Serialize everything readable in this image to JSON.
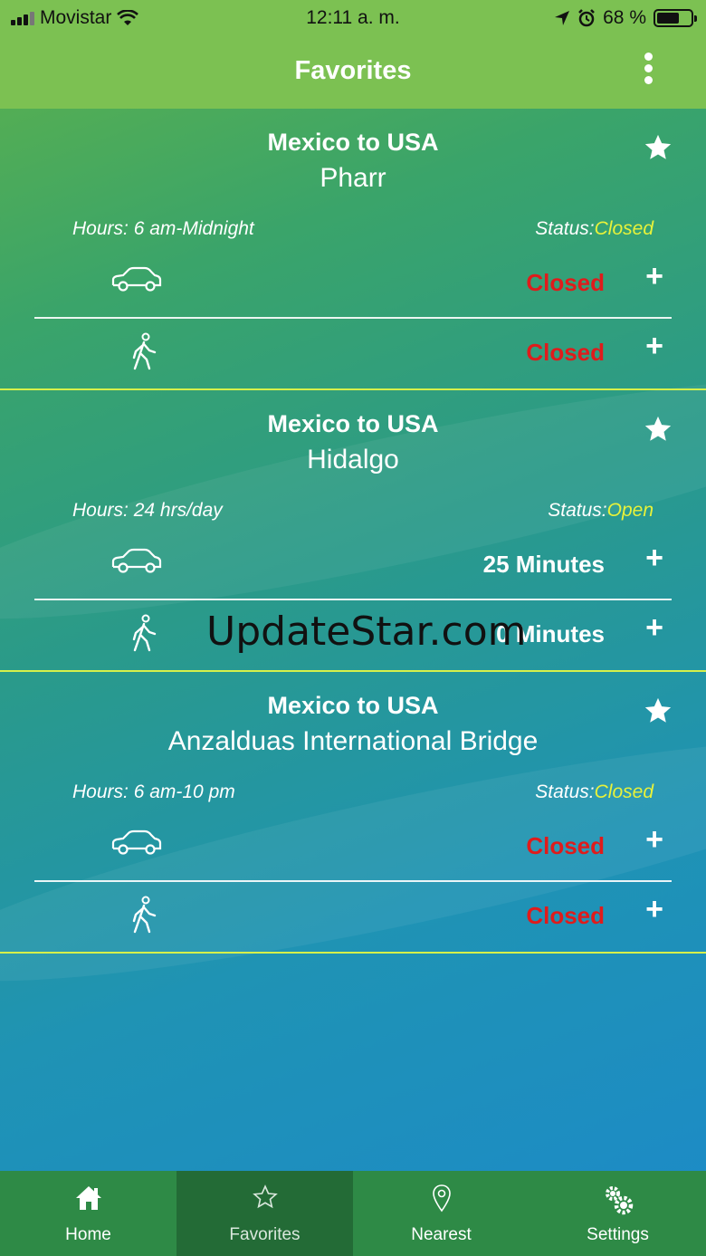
{
  "status_bar": {
    "carrier": "Movistar",
    "time": "12:11 a. m.",
    "battery": "68 %",
    "battery_level": 0.68
  },
  "header": {
    "title": "Favorites"
  },
  "labels": {
    "hours": "Hours:",
    "status": "Status:"
  },
  "cards": [
    {
      "direction": "Mexico to USA",
      "bridge": "Pharr",
      "hours": "6 am-Midnight",
      "status": "Closed",
      "car_wait": "Closed",
      "pedestrian_wait": "Closed"
    },
    {
      "direction": "Mexico to USA",
      "bridge": "Hidalgo",
      "hours": "24 hrs/day",
      "status": "Open",
      "car_wait": "25 Minutes",
      "pedestrian_wait": "0 Minutes"
    },
    {
      "direction": "Mexico to USA",
      "bridge": "Anzalduas International Bridge",
      "hours": "6 am-10 pm",
      "status": "Closed",
      "car_wait": "Closed",
      "pedestrian_wait": "Closed"
    }
  ],
  "watermark": "UpdateStar.com",
  "tabs": [
    {
      "label": "Home",
      "icon": "home-icon"
    },
    {
      "label": "Favorites",
      "icon": "star-outline-icon",
      "active": true
    },
    {
      "label": "Nearest",
      "icon": "location-pin-icon"
    },
    {
      "label": "Settings",
      "icon": "gears-icon"
    }
  ],
  "colors": {
    "header": "#7cc152",
    "closed": "#e01b1b",
    "status_value": "#e8f23a",
    "divider": "#d6f04a",
    "tabbar": "#2e8a46"
  }
}
